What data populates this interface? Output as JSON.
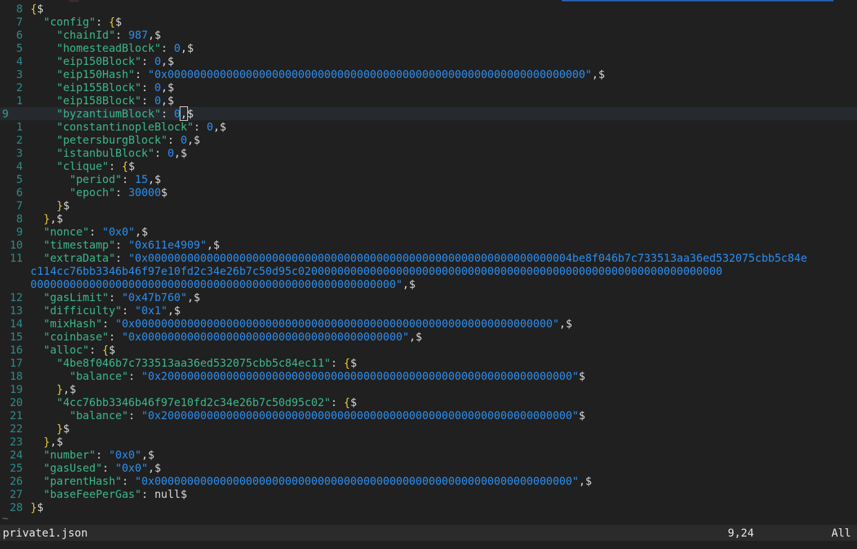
{
  "editor": {
    "filename": "private1.json",
    "cursor_position": "9,24",
    "scroll_percent": "All",
    "tilde": "~",
    "cursor_line_index": 8,
    "lines": [
      {
        "n": "8",
        "segs": [
          [
            "b",
            "{"
          ],
          [
            "p",
            "$"
          ]
        ]
      },
      {
        "n": "7",
        "segs": [
          [
            "p",
            "  "
          ],
          [
            "k",
            "\"config\""
          ],
          [
            "p",
            ": "
          ],
          [
            "b",
            "{"
          ],
          [
            "p",
            "$"
          ]
        ]
      },
      {
        "n": "6",
        "segs": [
          [
            "p",
            "    "
          ],
          [
            "k",
            "\"chainId\""
          ],
          [
            "p",
            ": "
          ],
          [
            "n",
            "987"
          ],
          [
            "p",
            ",$"
          ]
        ]
      },
      {
        "n": "5",
        "segs": [
          [
            "p",
            "    "
          ],
          [
            "k",
            "\"homesteadBlock\""
          ],
          [
            "p",
            ": "
          ],
          [
            "n",
            "0"
          ],
          [
            "p",
            ",$"
          ]
        ]
      },
      {
        "n": "4",
        "segs": [
          [
            "p",
            "    "
          ],
          [
            "k",
            "\"eip150Block\""
          ],
          [
            "p",
            ": "
          ],
          [
            "n",
            "0"
          ],
          [
            "p",
            ",$"
          ]
        ]
      },
      {
        "n": "3",
        "segs": [
          [
            "p",
            "    "
          ],
          [
            "k",
            "\"eip150Hash\""
          ],
          [
            "p",
            ": "
          ],
          [
            "s",
            "\"0x0000000000000000000000000000000000000000000000000000000000000000\""
          ],
          [
            "p",
            ",$"
          ]
        ]
      },
      {
        "n": "2",
        "segs": [
          [
            "p",
            "    "
          ],
          [
            "k",
            "\"eip155Block\""
          ],
          [
            "p",
            ": "
          ],
          [
            "n",
            "0"
          ],
          [
            "p",
            ",$"
          ]
        ]
      },
      {
        "n": "1",
        "segs": [
          [
            "p",
            "    "
          ],
          [
            "k",
            "\"eip158Block\""
          ],
          [
            "p",
            ": "
          ],
          [
            "n",
            "0"
          ],
          [
            "p",
            ",$"
          ]
        ]
      },
      {
        "n": "9",
        "cur": true,
        "segs": [
          [
            "p",
            "    "
          ],
          [
            "k",
            "\"byzantiumBlock\""
          ],
          [
            "p",
            ": "
          ],
          [
            "n",
            "0"
          ],
          [
            "c",
            ","
          ],
          [
            "p",
            "$"
          ]
        ]
      },
      {
        "n": "1",
        "segs": [
          [
            "p",
            "    "
          ],
          [
            "k",
            "\"constantinopleBlock\""
          ],
          [
            "p",
            ": "
          ],
          [
            "n",
            "0"
          ],
          [
            "p",
            ",$"
          ]
        ]
      },
      {
        "n": "2",
        "segs": [
          [
            "p",
            "    "
          ],
          [
            "k",
            "\"petersburgBlock\""
          ],
          [
            "p",
            ": "
          ],
          [
            "n",
            "0"
          ],
          [
            "p",
            ",$"
          ]
        ]
      },
      {
        "n": "3",
        "segs": [
          [
            "p",
            "    "
          ],
          [
            "k",
            "\"istanbulBlock\""
          ],
          [
            "p",
            ": "
          ],
          [
            "n",
            "0"
          ],
          [
            "p",
            ",$"
          ]
        ]
      },
      {
        "n": "4",
        "segs": [
          [
            "p",
            "    "
          ],
          [
            "k",
            "\"clique\""
          ],
          [
            "p",
            ": "
          ],
          [
            "b",
            "{"
          ],
          [
            "p",
            "$"
          ]
        ]
      },
      {
        "n": "5",
        "segs": [
          [
            "p",
            "      "
          ],
          [
            "k",
            "\"period\""
          ],
          [
            "p",
            ": "
          ],
          [
            "n",
            "15"
          ],
          [
            "p",
            ",$"
          ]
        ]
      },
      {
        "n": "6",
        "segs": [
          [
            "p",
            "      "
          ],
          [
            "k",
            "\"epoch\""
          ],
          [
            "p",
            ": "
          ],
          [
            "n",
            "30000"
          ],
          [
            "p",
            "$"
          ]
        ]
      },
      {
        "n": "7",
        "segs": [
          [
            "p",
            "    "
          ],
          [
            "b",
            "}"
          ],
          [
            "p",
            "$"
          ]
        ]
      },
      {
        "n": "8",
        "segs": [
          [
            "p",
            "  "
          ],
          [
            "b",
            "}"
          ],
          [
            "p",
            ",$"
          ]
        ]
      },
      {
        "n": "9",
        "segs": [
          [
            "p",
            "  "
          ],
          [
            "k",
            "\"nonce\""
          ],
          [
            "p",
            ": "
          ],
          [
            "s",
            "\"0x0\""
          ],
          [
            "p",
            ",$"
          ]
        ]
      },
      {
        "n": "10",
        "segs": [
          [
            "p",
            "  "
          ],
          [
            "k",
            "\"timestamp\""
          ],
          [
            "p",
            ": "
          ],
          [
            "s",
            "\"0x611e4909\""
          ],
          [
            "p",
            ",$"
          ]
        ]
      },
      {
        "n": "11",
        "segs": [
          [
            "p",
            "  "
          ],
          [
            "k",
            "\"extraData\""
          ],
          [
            "p",
            ": "
          ],
          [
            "s",
            "\"0x00000000000000000000000000000000000000000000000000000000000000004be8f046b7c733513aa36ed532075cbb5c84e"
          ]
        ]
      },
      {
        "n": "",
        "segs": [
          [
            "s",
            "c114cc76bb3346b46f97e10fd2c34e26b7c50d95c02000000000000000000000000000000000000000000000000000000000000000"
          ]
        ]
      },
      {
        "n": "",
        "segs": [
          [
            "s",
            "00000000000000000000000000000000000000000000000000000000\""
          ],
          [
            "p",
            ",$"
          ]
        ]
      },
      {
        "n": "12",
        "segs": [
          [
            "p",
            "  "
          ],
          [
            "k",
            "\"gasLimit\""
          ],
          [
            "p",
            ": "
          ],
          [
            "s",
            "\"0x47b760\""
          ],
          [
            "p",
            ",$"
          ]
        ]
      },
      {
        "n": "13",
        "segs": [
          [
            "p",
            "  "
          ],
          [
            "k",
            "\"difficulty\""
          ],
          [
            "p",
            ": "
          ],
          [
            "s",
            "\"0x1\""
          ],
          [
            "p",
            ",$"
          ]
        ]
      },
      {
        "n": "14",
        "segs": [
          [
            "p",
            "  "
          ],
          [
            "k",
            "\"mixHash\""
          ],
          [
            "p",
            ": "
          ],
          [
            "s",
            "\"0x0000000000000000000000000000000000000000000000000000000000000000\""
          ],
          [
            "p",
            ",$"
          ]
        ]
      },
      {
        "n": "15",
        "segs": [
          [
            "p",
            "  "
          ],
          [
            "k",
            "\"coinbase\""
          ],
          [
            "p",
            ": "
          ],
          [
            "s",
            "\"0x0000000000000000000000000000000000000000\""
          ],
          [
            "p",
            ",$"
          ]
        ]
      },
      {
        "n": "16",
        "segs": [
          [
            "p",
            "  "
          ],
          [
            "k",
            "\"alloc\""
          ],
          [
            "p",
            ": "
          ],
          [
            "b",
            "{"
          ],
          [
            "p",
            "$"
          ]
        ]
      },
      {
        "n": "17",
        "segs": [
          [
            "p",
            "    "
          ],
          [
            "k",
            "\"4be8f046b7c733513aa36ed532075cbb5c84ec11\""
          ],
          [
            "p",
            ": "
          ],
          [
            "b",
            "{"
          ],
          [
            "p",
            "$"
          ]
        ]
      },
      {
        "n": "18",
        "segs": [
          [
            "p",
            "      "
          ],
          [
            "k",
            "\"balance\""
          ],
          [
            "p",
            ": "
          ],
          [
            "s",
            "\"0x200000000000000000000000000000000000000000000000000000000000000\""
          ],
          [
            "p",
            "$"
          ]
        ]
      },
      {
        "n": "19",
        "segs": [
          [
            "p",
            "    "
          ],
          [
            "b",
            "}"
          ],
          [
            "p",
            ",$"
          ]
        ]
      },
      {
        "n": "20",
        "segs": [
          [
            "p",
            "    "
          ],
          [
            "k",
            "\"4cc76bb3346b46f97e10fd2c34e26b7c50d95c02\""
          ],
          [
            "p",
            ": "
          ],
          [
            "b",
            "{"
          ],
          [
            "p",
            "$"
          ]
        ]
      },
      {
        "n": "21",
        "segs": [
          [
            "p",
            "      "
          ],
          [
            "k",
            "\"balance\""
          ],
          [
            "p",
            ": "
          ],
          [
            "s",
            "\"0x200000000000000000000000000000000000000000000000000000000000000\""
          ],
          [
            "p",
            "$"
          ]
        ]
      },
      {
        "n": "22",
        "segs": [
          [
            "p",
            "    "
          ],
          [
            "b",
            "}"
          ],
          [
            "p",
            "$"
          ]
        ]
      },
      {
        "n": "23",
        "segs": [
          [
            "p",
            "  "
          ],
          [
            "b",
            "}"
          ],
          [
            "p",
            ",$"
          ]
        ]
      },
      {
        "n": "24",
        "segs": [
          [
            "p",
            "  "
          ],
          [
            "k",
            "\"number\""
          ],
          [
            "p",
            ": "
          ],
          [
            "s",
            "\"0x0\""
          ],
          [
            "p",
            ",$"
          ]
        ]
      },
      {
        "n": "25",
        "segs": [
          [
            "p",
            "  "
          ],
          [
            "k",
            "\"gasUsed\""
          ],
          [
            "p",
            ": "
          ],
          [
            "s",
            "\"0x0\""
          ],
          [
            "p",
            ",$"
          ]
        ]
      },
      {
        "n": "26",
        "segs": [
          [
            "p",
            "  "
          ],
          [
            "k",
            "\"parentHash\""
          ],
          [
            "p",
            ": "
          ],
          [
            "s",
            "\"0x0000000000000000000000000000000000000000000000000000000000000000\""
          ],
          [
            "p",
            ",$"
          ]
        ]
      },
      {
        "n": "27",
        "segs": [
          [
            "p",
            "  "
          ],
          [
            "k",
            "\"baseFeePerGas\""
          ],
          [
            "p",
            ": null$"
          ]
        ]
      },
      {
        "n": "28",
        "segs": [
          [
            "b",
            "}"
          ],
          [
            "p",
            "$"
          ]
        ]
      }
    ]
  }
}
